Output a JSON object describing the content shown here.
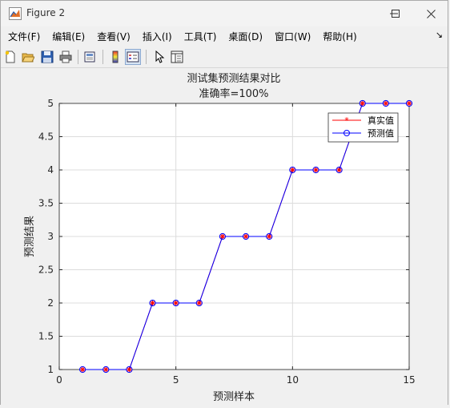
{
  "window": {
    "title": "Figure 2"
  },
  "menus": [
    "文件(F)",
    "编辑(E)",
    "查看(V)",
    "插入(I)",
    "工具(T)",
    "桌面(D)",
    "窗口(W)",
    "帮助(H)"
  ],
  "menu_end_glyph": "↘",
  "toolbar": [
    "new-file",
    "open",
    "save",
    "print",
    "print-preview",
    "colorbar",
    "legend",
    "pointer",
    "property-editor"
  ],
  "chart_data": {
    "type": "line",
    "title": "测试集预测结果对比",
    "subtitle": "准确率=100%",
    "xlabel": "预测样本",
    "ylabel": "预测结果",
    "xlim": [
      0,
      15
    ],
    "ylim": [
      1,
      5
    ],
    "xticks": [
      0,
      5,
      10,
      15
    ],
    "yticks": [
      1,
      1.5,
      2,
      2.5,
      3,
      3.5,
      4,
      4.5,
      5
    ],
    "x": [
      1,
      2,
      3,
      4,
      5,
      6,
      7,
      8,
      9,
      10,
      11,
      12,
      13,
      14,
      15
    ],
    "grid": true,
    "legend_position": "top-right",
    "series": [
      {
        "name": "真实值",
        "values": [
          1,
          1,
          1,
          2,
          2,
          2,
          3,
          3,
          3,
          4,
          4,
          4,
          5,
          5,
          5
        ],
        "color": "#ff0000",
        "marker": "asterisk"
      },
      {
        "name": "预测值",
        "values": [
          1,
          1,
          1,
          2,
          2,
          2,
          3,
          3,
          3,
          4,
          4,
          4,
          5,
          5,
          5
        ],
        "color": "#0000ff",
        "marker": "circle"
      }
    ]
  }
}
